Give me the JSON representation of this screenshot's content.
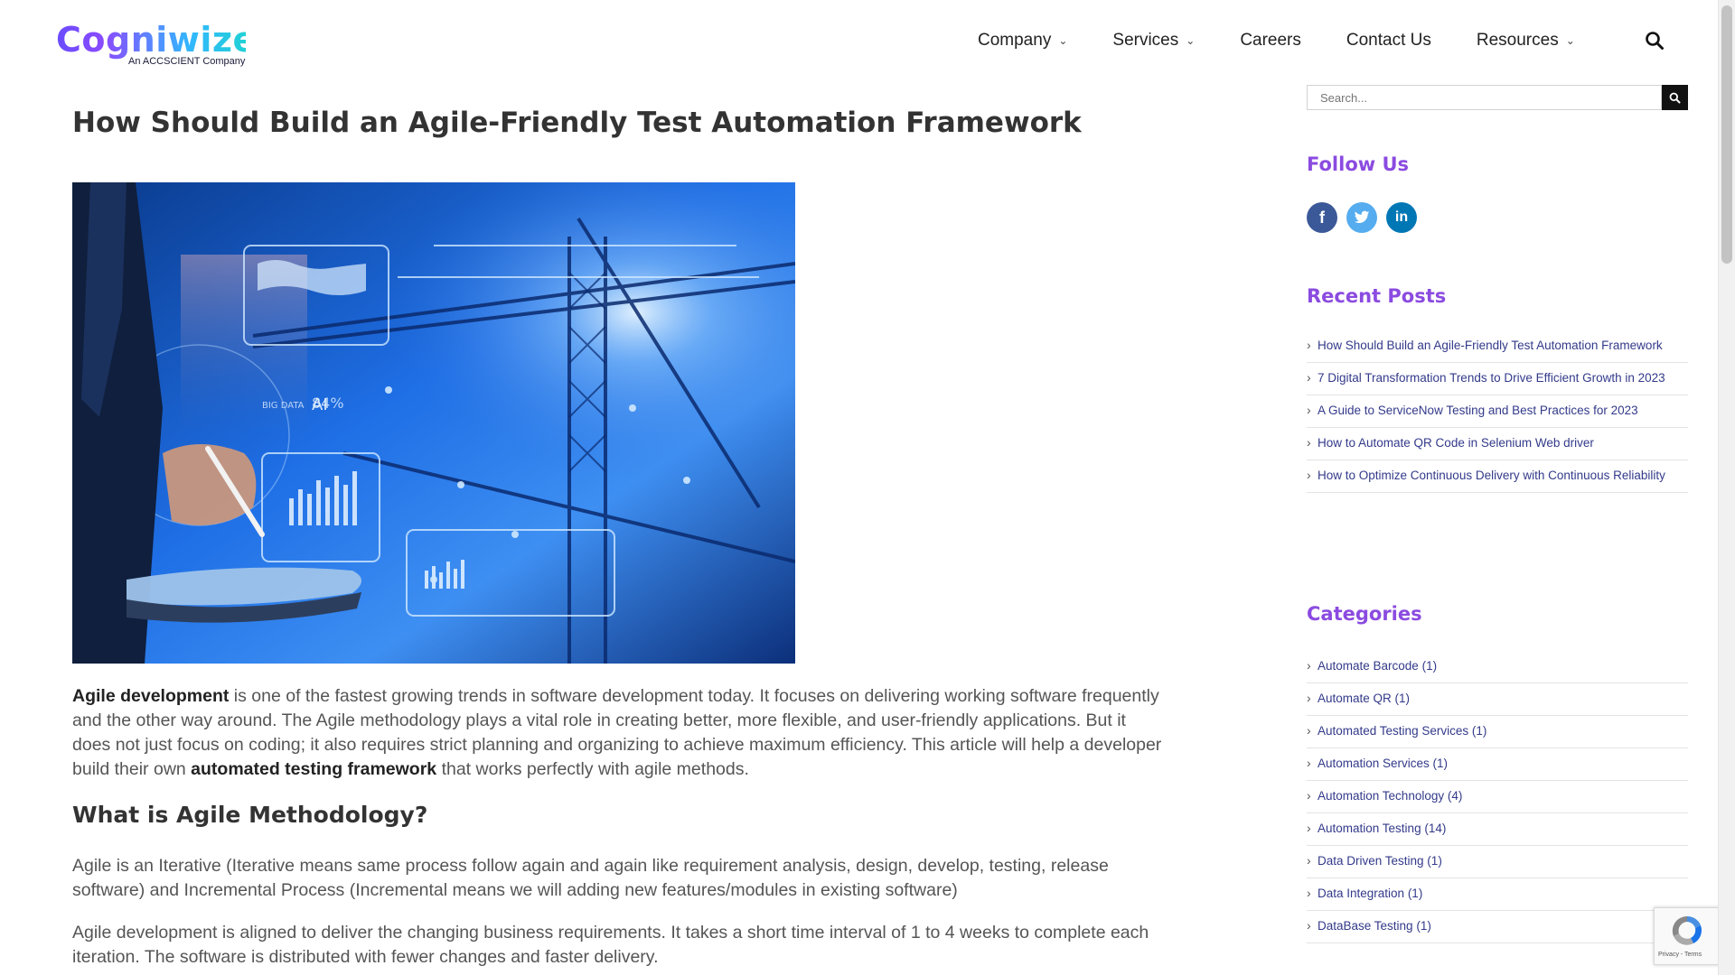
{
  "header": {
    "logo_text": "Cogniwize",
    "logo_subtitle": "An ACCSCIENT Company",
    "nav": [
      {
        "label": "Company",
        "dropdown": true
      },
      {
        "label": "Services",
        "dropdown": true
      },
      {
        "label": "Careers",
        "dropdown": false
      },
      {
        "label": "Contact Us",
        "dropdown": false
      },
      {
        "label": "Resources",
        "dropdown": true
      }
    ]
  },
  "post": {
    "title": "How Should Build an Agile-Friendly Test Automation Framework",
    "hero_labels": {
      "ai": "AI",
      "big_data": "BIG DATA",
      "percent": "84%"
    },
    "p1_bold1": "Agile development",
    "p1_text1": " is one of the fastest growing trends in software development today. It focuses on delivering working software frequently and the other way around. The Agile methodology plays a vital role in creating better, more flexible, and user-friendly applications. But it does not just focus on coding; it also requires strict planning and organizing to achieve maximum efficiency. This article will help a developer build their own ",
    "p1_bold2": "automated testing framework",
    "p1_text2": " that works perfectly with agile methods.",
    "h2": "What is Agile Methodology?",
    "p2": "Agile is an Iterative (Iterative means same process follow again and again like requirement analysis, design, develop, testing, release software) and Incremental Process (Incremental means we will adding new features/modules in existing software)",
    "p3": "Agile development is aligned to deliver the changing business requirements. It takes a short time interval of 1 to 4 weeks to complete each iteration. The software is distributed with fewer changes and faster delivery."
  },
  "sidebar": {
    "search_placeholder": "Search...",
    "follow_heading": "Follow Us",
    "social": [
      {
        "icon": "facebook-icon",
        "glyph": "f",
        "color": "#3b5998"
      },
      {
        "icon": "twitter-icon",
        "glyph": "t",
        "color": "#55acee"
      },
      {
        "icon": "linkedin-icon",
        "glyph": "in",
        "color": "#0077b5"
      }
    ],
    "recent_heading": "Recent Posts",
    "recent": [
      "How Should Build an Agile-Friendly Test Automation Framework",
      "7 Digital Transformation Trends to Drive Efficient Growth in 2023",
      "A Guide to ServiceNow Testing and Best Practices for 2023",
      "How to Automate QR Code in Selenium Web driver",
      "How to Optimize Continuous Delivery with Continuous Reliability"
    ],
    "categories_heading": "Categories",
    "categories": [
      "Automate Barcode (1)",
      "Automate QR (1)",
      "Automated Testing Services (1)",
      "Automation Services (1)",
      "Automation Technology (4)",
      "Automation Testing (14)",
      "Data Driven Testing (1)",
      "Data Integration (1)",
      "DataBase Testing (1)"
    ]
  },
  "recaptcha": {
    "text": "Privacy - Terms"
  },
  "colors": {
    "accent": "#8b4be0",
    "link": "#333a8a",
    "text": "#555555",
    "heading": "#333333"
  }
}
